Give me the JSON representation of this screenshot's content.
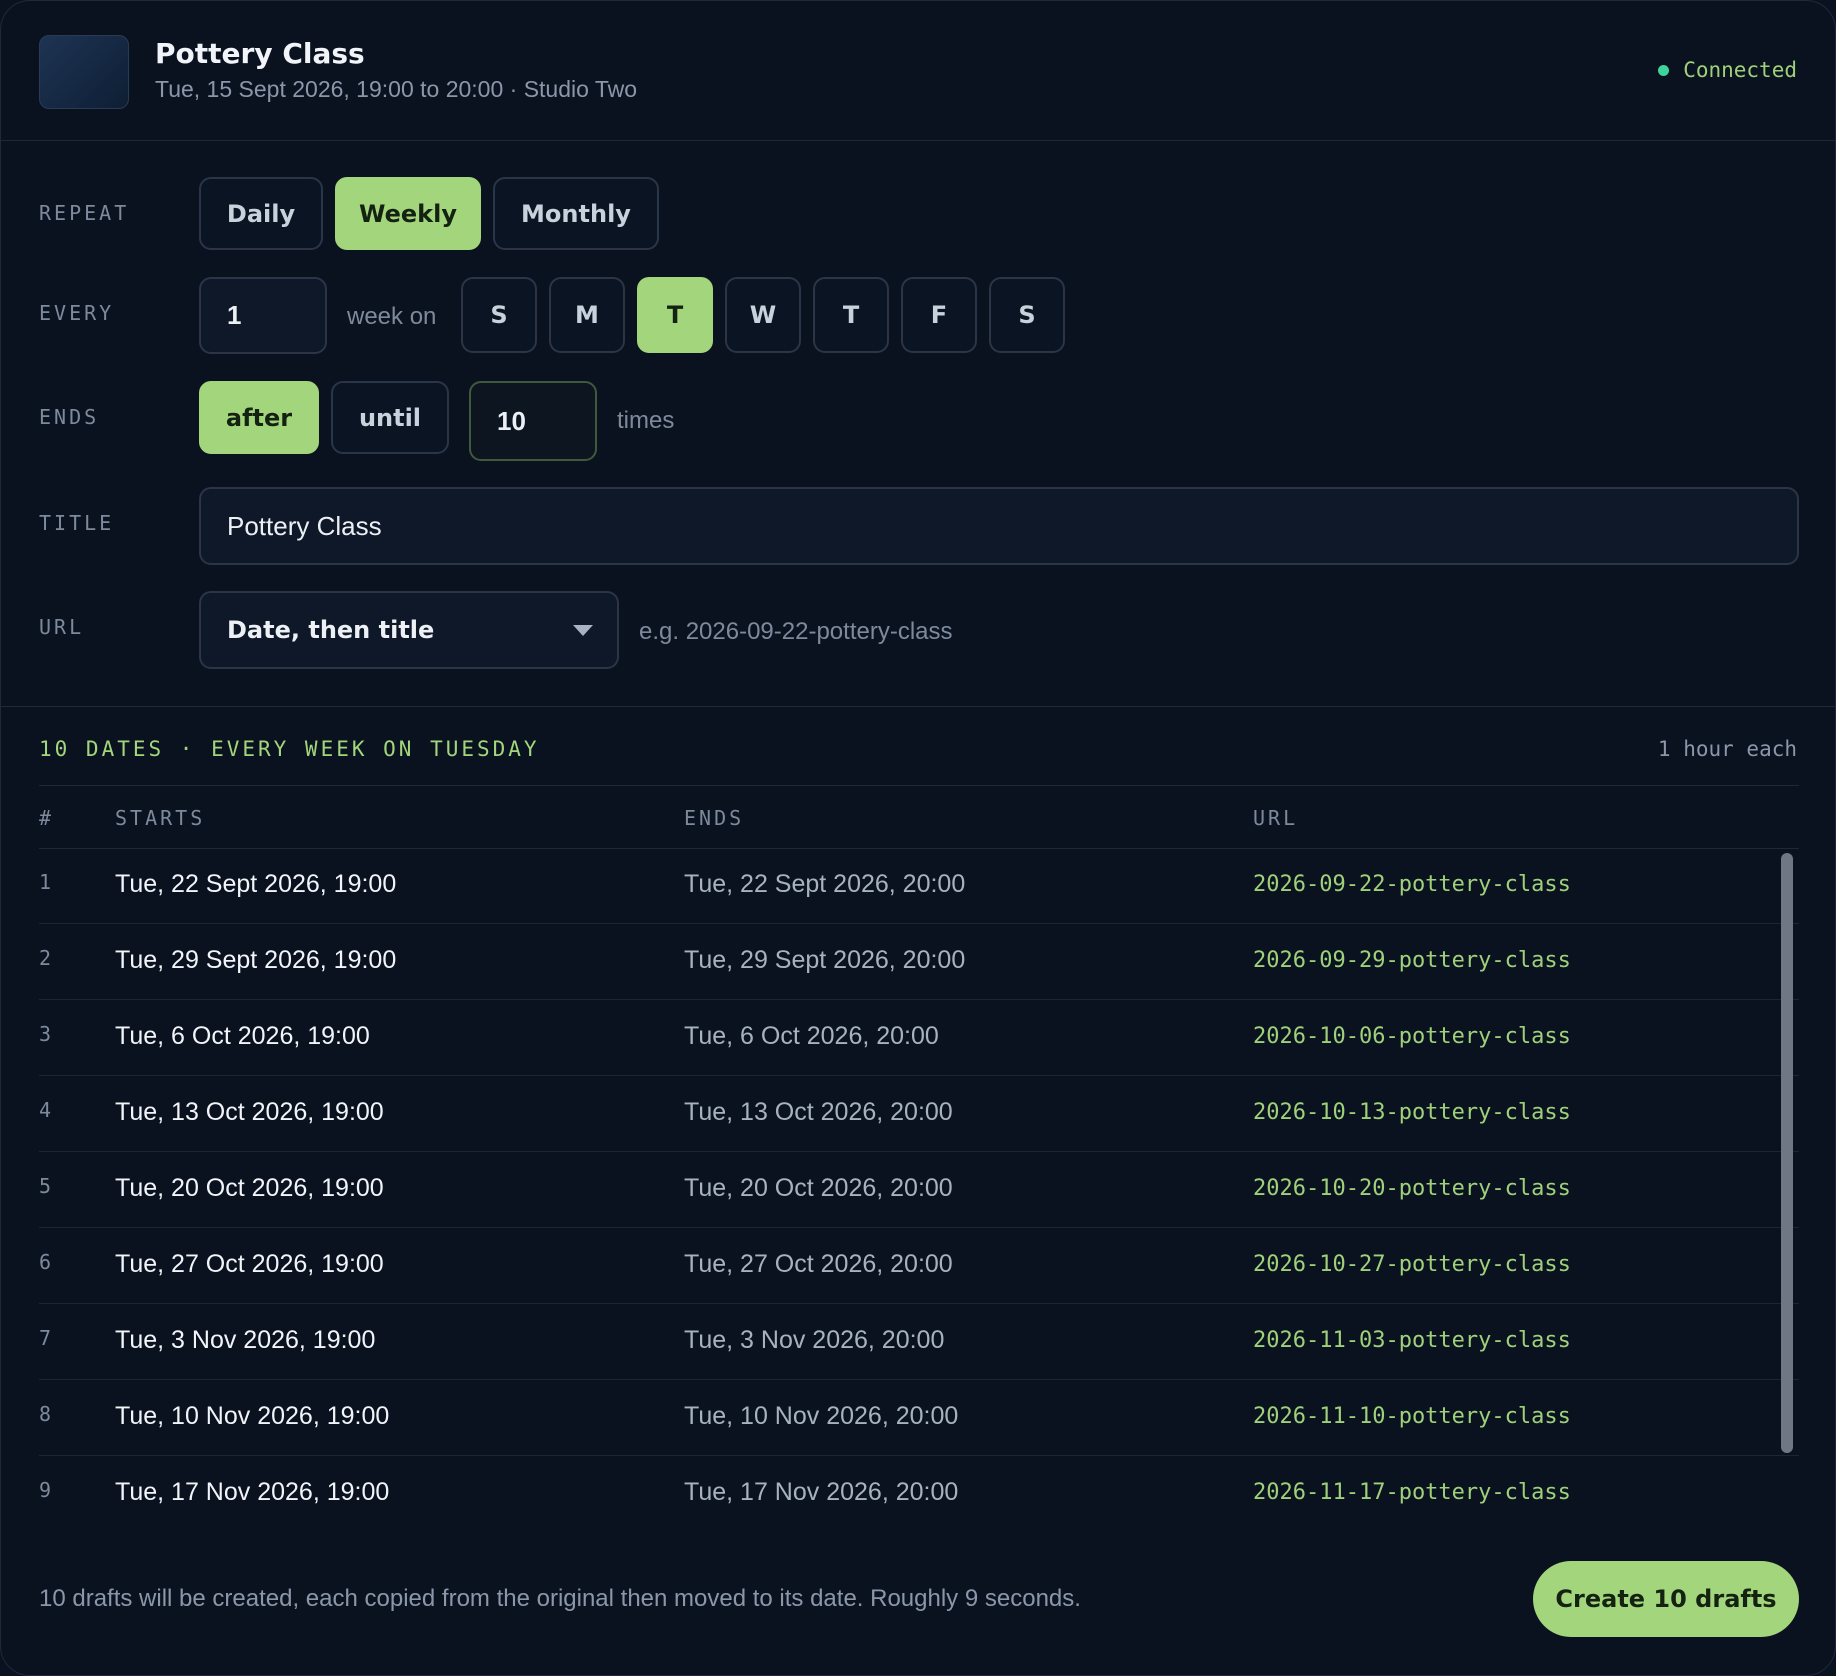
{
  "header": {
    "title": "Pottery Class",
    "subtitle": "Tue, 15 Sept 2026, 19:00 to 20:00 · Studio Two",
    "status": "Connected",
    "status_color": "#3ed39a"
  },
  "form": {
    "repeat": {
      "label": "REPEAT",
      "options": [
        "Daily",
        "Weekly",
        "Monthly"
      ],
      "selected": "Weekly"
    },
    "every": {
      "label": "EVERY",
      "value": "1",
      "unit_text": "week on",
      "days": [
        "S",
        "M",
        "T",
        "W",
        "T",
        "F",
        "S"
      ],
      "selected_day_index": 2
    },
    "ends": {
      "label": "ENDS",
      "options": [
        "after",
        "until"
      ],
      "selected": "after",
      "count": "10",
      "suffix": "times"
    },
    "title": {
      "label": "TITLE",
      "value": "Pottery Class"
    },
    "url": {
      "label": "URL",
      "selected": "Date, then title",
      "example": "e.g. 2026-09-22-pottery-class"
    }
  },
  "summary": {
    "left": "10 DATES · EVERY WEEK ON TUESDAY",
    "right": "1 hour each"
  },
  "table": {
    "headers": [
      "#",
      "STARTS",
      "ENDS",
      "URL"
    ],
    "rows": [
      {
        "num": "1",
        "start": "Tue, 22 Sept 2026, 19:00",
        "end": "Tue, 22 Sept 2026, 20:00",
        "url": "2026-09-22-pottery-class"
      },
      {
        "num": "2",
        "start": "Tue, 29 Sept 2026, 19:00",
        "end": "Tue, 29 Sept 2026, 20:00",
        "url": "2026-09-29-pottery-class"
      },
      {
        "num": "3",
        "start": "Tue, 6 Oct 2026, 19:00",
        "end": "Tue, 6 Oct 2026, 20:00",
        "url": "2026-10-06-pottery-class"
      },
      {
        "num": "4",
        "start": "Tue, 13 Oct 2026, 19:00",
        "end": "Tue, 13 Oct 2026, 20:00",
        "url": "2026-10-13-pottery-class"
      },
      {
        "num": "5",
        "start": "Tue, 20 Oct 2026, 19:00",
        "end": "Tue, 20 Oct 2026, 20:00",
        "url": "2026-10-20-pottery-class"
      },
      {
        "num": "6",
        "start": "Tue, 27 Oct 2026, 19:00",
        "end": "Tue, 27 Oct 2026, 20:00",
        "url": "2026-10-27-pottery-class"
      },
      {
        "num": "7",
        "start": "Tue, 3 Nov 2026, 19:00",
        "end": "Tue, 3 Nov 2026, 20:00",
        "url": "2026-11-03-pottery-class"
      },
      {
        "num": "8",
        "start": "Tue, 10 Nov 2026, 19:00",
        "end": "Tue, 10 Nov 2026, 20:00",
        "url": "2026-11-10-pottery-class"
      },
      {
        "num": "9",
        "start": "Tue, 17 Nov 2026, 19:00",
        "end": "Tue, 17 Nov 2026, 20:00",
        "url": "2026-11-17-pottery-class"
      }
    ]
  },
  "footer": {
    "note": "10 drafts will be created, each copied from the original then moved to its date. Roughly 9 seconds.",
    "create_label": "Create 10 drafts"
  },
  "colors": {
    "accent": "#a3d67c",
    "background": "#0a1220",
    "url_text": "#9fd07a"
  }
}
